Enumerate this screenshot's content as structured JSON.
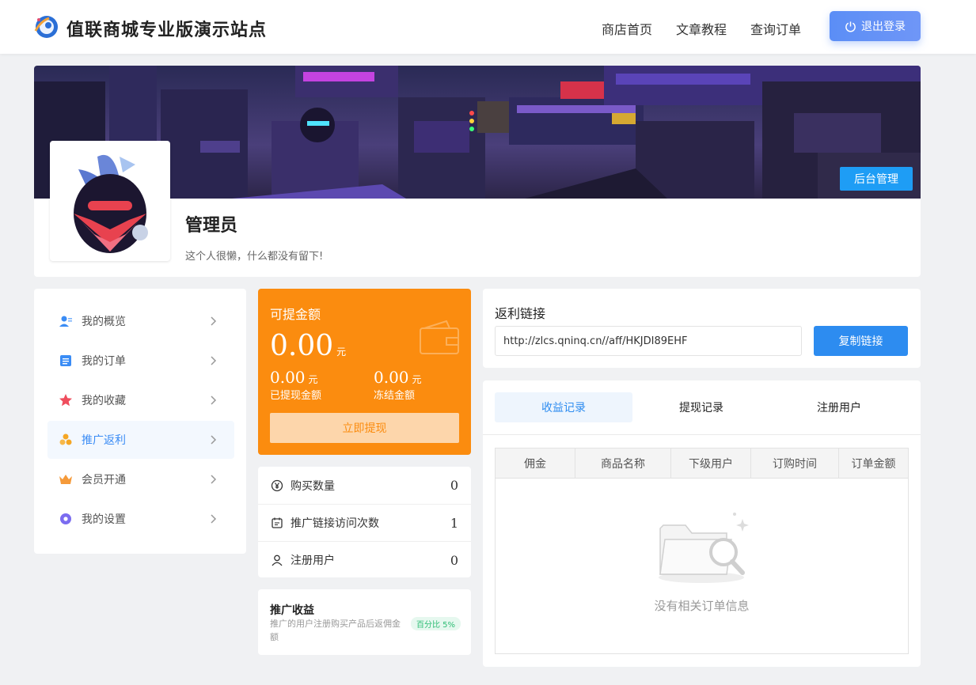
{
  "header": {
    "site_title": "值联商城专业版演示站点",
    "nav": [
      "商店首页",
      "文章教程",
      "查询订单"
    ],
    "logout_label": "退出登录"
  },
  "profile": {
    "admin_button": "后台管理",
    "username": "管理员",
    "bio": "这个人很懒，什么都没有留下!"
  },
  "sidebar": {
    "items": [
      {
        "label": "我的概览",
        "icon": "user-overview-icon",
        "active": false
      },
      {
        "label": "我的订单",
        "icon": "order-list-icon",
        "active": false
      },
      {
        "label": "我的收藏",
        "icon": "star-icon",
        "active": false
      },
      {
        "label": "推广返利",
        "icon": "coins-icon",
        "active": true
      },
      {
        "label": "会员开通",
        "icon": "crown-icon",
        "active": false
      },
      {
        "label": "我的设置",
        "icon": "settings-icon",
        "active": false
      }
    ]
  },
  "balance": {
    "label": "可提金额",
    "amount": "0.00",
    "unit": "元",
    "withdrawn_amount": "0.00",
    "withdrawn_label": "已提现金额",
    "frozen_amount": "0.00",
    "frozen_label": "冻结金额",
    "withdraw_button": "立即提现"
  },
  "stats": [
    {
      "label": "购买数量",
      "value": "0",
      "icon": "yen-coin-icon"
    },
    {
      "label": "推广链接访问次数",
      "value": "1",
      "icon": "calendar-icon"
    },
    {
      "label": "注册用户",
      "value": "0",
      "icon": "user-icon"
    }
  ],
  "promo": {
    "title": "推广收益",
    "desc": "推广的用户注册购买产品后返佣金额",
    "badge": "百分比 5%"
  },
  "rebate": {
    "title": "返利链接",
    "link": "http://zlcs.qninq.cn//aff/HKJDI89EHF",
    "copy_button": "复制链接"
  },
  "records": {
    "tabs": [
      "收益记录",
      "提现记录",
      "注册用户"
    ],
    "columns": [
      "佣金",
      "商品名称",
      "下级用户",
      "订购时间",
      "订单金额"
    ],
    "empty_text": "没有相关订单信息"
  },
  "colors": {
    "accent": "#2d8cf0",
    "balance_bg": "#fb8c0f",
    "logout_bg": "#5b8ef6"
  }
}
